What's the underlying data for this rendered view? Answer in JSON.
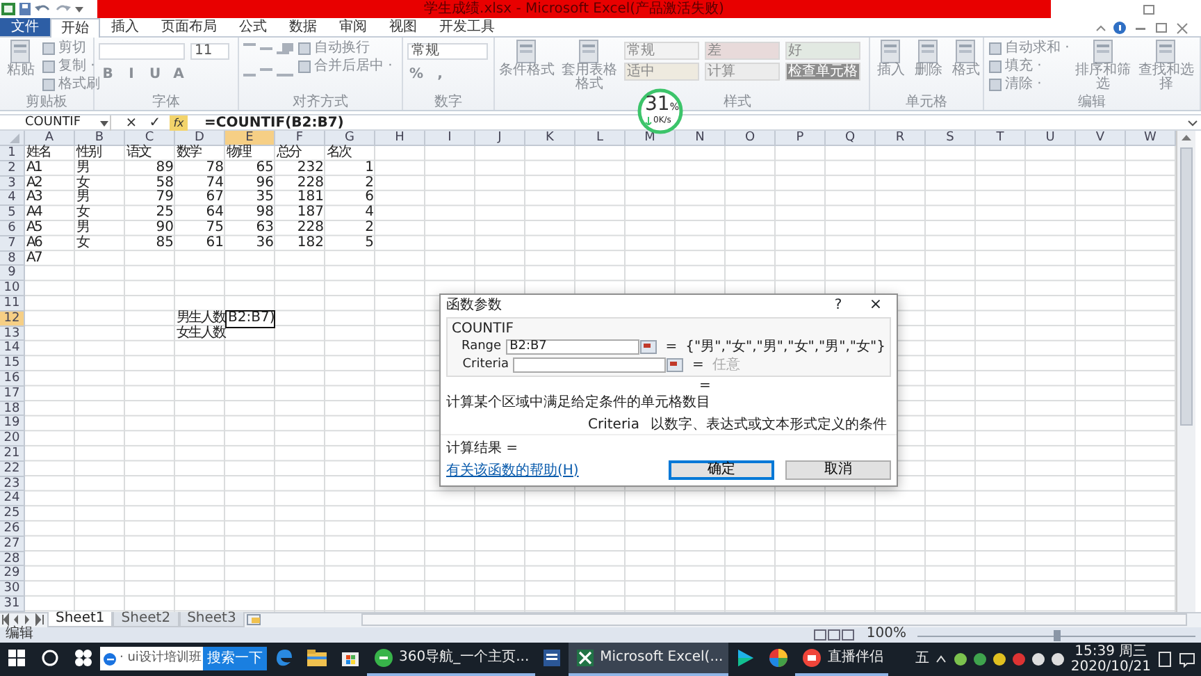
{
  "title_bar": {
    "title": "学生成绩.xlsx - Microsoft Excel(产品激活失败)"
  },
  "ribbon_tabs": [
    {
      "label": "文件",
      "kind": "file",
      "selected": false
    },
    {
      "label": "开始",
      "kind": "tab",
      "selected": true
    },
    {
      "label": "插入",
      "kind": "tab",
      "selected": false
    },
    {
      "label": "页面布局",
      "kind": "tab",
      "selected": false
    },
    {
      "label": "公式",
      "kind": "tab",
      "selected": false
    },
    {
      "label": "数据",
      "kind": "tab",
      "selected": false
    },
    {
      "label": "审阅",
      "kind": "tab",
      "selected": false
    },
    {
      "label": "视图",
      "kind": "tab",
      "selected": false
    },
    {
      "label": "开发工具",
      "kind": "tab",
      "selected": false
    }
  ],
  "ribbon_groups": [
    {
      "label": "剪贴板",
      "kind": "clipboard",
      "items": [
        {
          "kind": "big",
          "label": "粘贴"
        },
        {
          "kind": "small",
          "label": "剪切"
        },
        {
          "kind": "small",
          "label": "复制 ·"
        },
        {
          "kind": "small",
          "label": "格式刷"
        }
      ]
    },
    {
      "label": "字体",
      "kind": "font",
      "items": [
        {
          "kind": "field"
        },
        {
          "kind": "field",
          "value": "11"
        },
        {
          "kind": "glyph",
          "label": "B"
        },
        {
          "kind": "glyph",
          "label": "I"
        },
        {
          "kind": "glyph",
          "label": "U"
        },
        {
          "kind": "glyph",
          "label": "A"
        }
      ]
    },
    {
      "label": "对齐方式",
      "kind": "alignment",
      "items": [
        {
          "kind": "small",
          "label": "自动换行"
        },
        {
          "kind": "small",
          "label": "合并后居中 ·"
        }
      ]
    },
    {
      "label": "数字",
      "kind": "number",
      "items": [
        {
          "kind": "field",
          "value": "常规"
        },
        {
          "kind": "glyph",
          "label": "%"
        },
        {
          "kind": "glyph",
          "label": ","
        }
      ]
    },
    {
      "label": "样式",
      "kind": "styles",
      "items": [
        {
          "kind": "big",
          "label": "条件格式"
        },
        {
          "kind": "big",
          "label": "套用表格格式"
        }
      ],
      "styles": [
        {
          "label": "常规",
          "color": "#f2f2f2"
        },
        {
          "label": "差",
          "color": "#e8dada"
        },
        {
          "label": "好",
          "color": "#e2e9e2"
        },
        {
          "label": "适中",
          "color": "#eeeadf"
        },
        {
          "label": "计算",
          "color": "#ececec"
        },
        {
          "label": "检查单元格",
          "color": "#8c8c8c"
        }
      ]
    },
    {
      "label": "单元格",
      "kind": "cells",
      "items": [
        {
          "kind": "big",
          "label": "插入"
        },
        {
          "kind": "big",
          "label": "删除"
        },
        {
          "kind": "big",
          "label": "格式"
        }
      ]
    },
    {
      "label": "编辑",
      "kind": "editing",
      "items": [
        {
          "kind": "small",
          "label": "自动求和 ·"
        },
        {
          "kind": "small",
          "label": "填充 ·"
        },
        {
          "kind": "small",
          "label": "清除 ·"
        },
        {
          "kind": "big",
          "label": "排序和筛选"
        },
        {
          "kind": "big",
          "label": "查找和选择"
        }
      ]
    }
  ],
  "formula_bar": {
    "name_box": "COUNTIF",
    "buttons": [
      "×",
      "✓",
      "fx"
    ],
    "formula": "=COUNTIF(B2:B7)"
  },
  "columns": [
    {
      "label": "A",
      "selected": false
    },
    {
      "label": "B",
      "selected": false
    },
    {
      "label": "C",
      "selected": false
    },
    {
      "label": "D",
      "selected": false
    },
    {
      "label": "E",
      "selected": true
    },
    {
      "label": "F",
      "selected": false
    },
    {
      "label": "G",
      "selected": false
    },
    {
      "label": "H",
      "selected": false
    },
    {
      "label": "I",
      "selected": false
    },
    {
      "label": "J",
      "selected": false
    },
    {
      "label": "K",
      "selected": false
    },
    {
      "label": "L",
      "selected": false
    },
    {
      "label": "M",
      "selected": false
    },
    {
      "label": "N",
      "selected": false
    },
    {
      "label": "O",
      "selected": false
    },
    {
      "label": "P",
      "selected": false
    },
    {
      "label": "Q",
      "selected": false
    },
    {
      "label": "R",
      "selected": false
    },
    {
      "label": "S",
      "selected": false
    },
    {
      "label": "T",
      "selected": false
    },
    {
      "label": "U",
      "selected": false
    },
    {
      "label": "V",
      "selected": false
    },
    {
      "label": "W",
      "selected": false
    }
  ],
  "rows": [
    {
      "header": "1",
      "selected": false,
      "cells": {
        "A": {
          "value": "姓名",
          "kind": "text"
        },
        "B": {
          "value": "性别",
          "kind": "text"
        },
        "C": {
          "value": "语文",
          "kind": "text"
        },
        "D": {
          "value": "数学",
          "kind": "text"
        },
        "E": {
          "value": "物理",
          "kind": "text"
        },
        "F": {
          "value": "总分",
          "kind": "text"
        },
        "G": {
          "value": "名次",
          "kind": "text"
        }
      }
    },
    {
      "header": "2",
      "selected": false,
      "cells": {
        "A": {
          "value": "A1",
          "kind": "text"
        },
        "B": {
          "value": "男",
          "kind": "text"
        },
        "C": {
          "value": "89",
          "kind": "number"
        },
        "D": {
          "value": "78",
          "kind": "number"
        },
        "E": {
          "value": "65",
          "kind": "number"
        },
        "F": {
          "value": "232",
          "kind": "number"
        },
        "G": {
          "value": "1",
          "kind": "number"
        }
      }
    },
    {
      "header": "3",
      "selected": false,
      "cells": {
        "A": {
          "value": "A2",
          "kind": "text"
        },
        "B": {
          "value": "女",
          "kind": "text"
        },
        "C": {
          "value": "58",
          "kind": "number"
        },
        "D": {
          "value": "74",
          "kind": "number"
        },
        "E": {
          "value": "96",
          "kind": "number"
        },
        "F": {
          "value": "228",
          "kind": "number"
        },
        "G": {
          "value": "2",
          "kind": "number"
        }
      }
    },
    {
      "header": "4",
      "selected": false,
      "cells": {
        "A": {
          "value": "A3",
          "kind": "text"
        },
        "B": {
          "value": "男",
          "kind": "text"
        },
        "C": {
          "value": "79",
          "kind": "number"
        },
        "D": {
          "value": "67",
          "kind": "number"
        },
        "E": {
          "value": "35",
          "kind": "number"
        },
        "F": {
          "value": "181",
          "kind": "number"
        },
        "G": {
          "value": "6",
          "kind": "number"
        }
      }
    },
    {
      "header": "5",
      "selected": false,
      "cells": {
        "A": {
          "value": "A4",
          "kind": "text"
        },
        "B": {
          "value": "女",
          "kind": "text"
        },
        "C": {
          "value": "25",
          "kind": "number"
        },
        "D": {
          "value": "64",
          "kind": "number"
        },
        "E": {
          "value": "98",
          "kind": "number"
        },
        "F": {
          "value": "187",
          "kind": "number"
        },
        "G": {
          "value": "4",
          "kind": "number"
        }
      }
    },
    {
      "header": "6",
      "selected": false,
      "cells": {
        "A": {
          "value": "A5",
          "kind": "text"
        },
        "B": {
          "value": "男",
          "kind": "text"
        },
        "C": {
          "value": "90",
          "kind": "number"
        },
        "D": {
          "value": "75",
          "kind": "number"
        },
        "E": {
          "value": "63",
          "kind": "number"
        },
        "F": {
          "value": "228",
          "kind": "number"
        },
        "G": {
          "value": "2",
          "kind": "number"
        }
      }
    },
    {
      "header": "7",
      "selected": false,
      "cells": {
        "A": {
          "value": "A6",
          "kind": "text"
        },
        "B": {
          "value": "女",
          "kind": "text"
        },
        "C": {
          "value": "85",
          "kind": "number"
        },
        "D": {
          "value": "61",
          "kind": "number"
        },
        "E": {
          "value": "36",
          "kind": "number"
        },
        "F": {
          "value": "182",
          "kind": "number"
        },
        "G": {
          "value": "5",
          "kind": "number"
        }
      }
    },
    {
      "header": "8",
      "selected": false,
      "cells": {
        "A": {
          "value": "A7",
          "kind": "text"
        }
      }
    },
    {
      "header": "9",
      "selected": false
    },
    {
      "header": "10",
      "selected": false
    },
    {
      "header": "11",
      "selected": false
    },
    {
      "header": "12",
      "selected": true,
      "cells": {
        "D": {
          "value": "男生人数",
          "kind": "text"
        },
        "E": {
          "value": "B2:B7)",
          "kind": "editing"
        }
      }
    },
    {
      "header": "13",
      "selected": false,
      "cells": {
        "D": {
          "value": "女生人数",
          "kind": "text"
        }
      }
    },
    {
      "header": "14",
      "selected": false
    },
    {
      "header": "15",
      "selected": false
    },
    {
      "header": "16",
      "selected": false
    },
    {
      "header": "17",
      "selected": false
    },
    {
      "header": "18",
      "selected": false
    },
    {
      "header": "19",
      "selected": false
    },
    {
      "header": "20",
      "selected": false
    },
    {
      "header": "21",
      "selected": false
    },
    {
      "header": "22",
      "selected": false
    },
    {
      "header": "23",
      "selected": false
    },
    {
      "header": "24",
      "selected": false
    },
    {
      "header": "25",
      "selected": false
    },
    {
      "header": "26",
      "selected": false
    },
    {
      "header": "27",
      "selected": false
    },
    {
      "header": "28",
      "selected": false
    },
    {
      "header": "29",
      "selected": false
    },
    {
      "header": "30",
      "selected": false
    },
    {
      "header": "31",
      "selected": false
    }
  ],
  "sheet_tabs": [
    {
      "label": "Sheet1",
      "selected": true
    },
    {
      "label": "Sheet2",
      "selected": false
    },
    {
      "label": "Sheet3",
      "selected": false
    }
  ],
  "status_bar": {
    "mode": "编辑",
    "zoom": "100%",
    "zoom_slider": {
      "level": 0.5
    }
  },
  "speed_meter": {
    "percent": "31",
    "unit": "%",
    "speed": "0K/s"
  },
  "dialog": {
    "title": "函数参数",
    "help": "?",
    "close": "×",
    "function": "COUNTIF",
    "arguments": [
      {
        "label": "Range",
        "value": "B2:B7",
        "sign": "=",
        "result": "{\"男\",\"女\",\"男\",\"女\",\"男\",\"女\"}",
        "muted": false
      },
      {
        "label": "Criteria",
        "sign": "=",
        "result": "任意",
        "muted": true
      }
    ],
    "result_sign": "=",
    "description": "计算某个区域中满足给定条件的单元格数目",
    "argument_name": "Criteria",
    "argument_help": "以数字、表达式或文本形式定义的条件",
    "result_label": "计算结果 =",
    "help_link": "有关该函数的帮助(H)",
    "buttons": [
      {
        "label": "确定",
        "kind": "default"
      },
      {
        "label": "取消",
        "kind": "normal"
      }
    ]
  },
  "taskbar": {
    "search_text": "· ui设计培训班",
    "search_button": "搜索一下",
    "apps": [
      {
        "kind": "edge",
        "running": false,
        "selected": false
      },
      {
        "kind": "folder",
        "running": false,
        "selected": false
      },
      {
        "kind": "store",
        "running": false,
        "selected": false
      },
      {
        "kind": "browser360",
        "label": "360导航_一个主页...",
        "running": true,
        "selected": false
      },
      {
        "kind": "word",
        "running": false,
        "selected": false
      },
      {
        "kind": "excel",
        "label": "Microsoft Excel(...",
        "running": true,
        "selected": true
      },
      {
        "kind": "player",
        "running": false,
        "selected": false
      },
      {
        "kind": "colorwheel",
        "running": false,
        "selected": false
      },
      {
        "kind": "live",
        "label": "直播伴侣",
        "running": true,
        "selected": false
      }
    ],
    "ime": "五",
    "time": "15:39 周三",
    "date": "2020/10/21"
  }
}
